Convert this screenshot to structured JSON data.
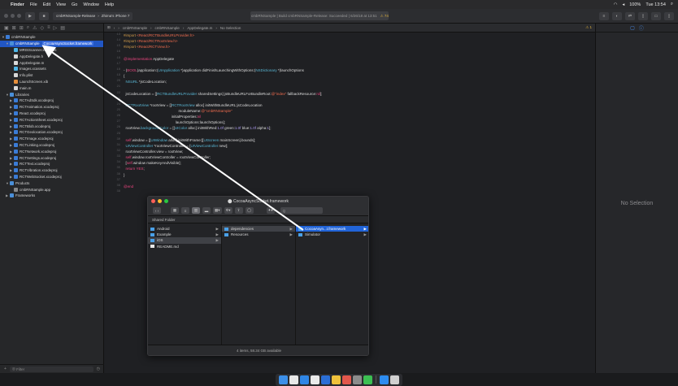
{
  "menubar": {
    "apple": "",
    "items": [
      "Finder",
      "File",
      "Edit",
      "View",
      "Go",
      "Window",
      "Help"
    ],
    "right": {
      "battery": "100%",
      "clock": "Tue 13:54"
    }
  },
  "toolbar": {
    "scheme": "cmbRNSample-Release",
    "device": "Zhima's iPhone 7",
    "status": "cmbRNSample | Build cmbRNSample-Release: Succeeded | 6/26/18 at 13:51",
    "warnings": "⚠ 74"
  },
  "navigator": {
    "rows": [
      {
        "label": "cmbRNSample",
        "icon": "proj",
        "disclosure": "▼",
        "indent": 0
      },
      {
        "label": "cmbRNSample",
        "icon": "folder",
        "disclosure": "▼",
        "indent": 1,
        "selected": true,
        "badge": "CocoaAsyncSocket.framework"
      },
      {
        "label": "MRISScanner.xcassets",
        "icon": "asset",
        "disclosure": "",
        "indent": 2
      },
      {
        "label": "AppDelegate.h",
        "icon": "file",
        "disclosure": "",
        "indent": 2
      },
      {
        "label": "AppDelegate.m",
        "icon": "file",
        "disclosure": "",
        "indent": 2
      },
      {
        "label": "Images.xcassets",
        "icon": "asset",
        "disclosure": "",
        "indent": 2
      },
      {
        "label": "Info.plist",
        "icon": "file",
        "disclosure": "",
        "indent": 2
      },
      {
        "label": "LaunchScreen.xib",
        "icon": "xib",
        "disclosure": "",
        "indent": 2
      },
      {
        "label": "main.m",
        "icon": "file",
        "disclosure": "",
        "indent": 2
      },
      {
        "label": "Libraries",
        "icon": "folder",
        "disclosure": "▼",
        "indent": 1
      },
      {
        "label": "RCTAdSdk.xcodeproj",
        "icon": "proj",
        "disclosure": "▶",
        "indent": 2
      },
      {
        "label": "RCTAnimation.xcodeproj",
        "icon": "proj",
        "disclosure": "▶",
        "indent": 2
      },
      {
        "label": "React.xcodeproj",
        "icon": "proj",
        "disclosure": "▶",
        "indent": 2
      },
      {
        "label": "RCTActionSheet.xcodeproj",
        "icon": "proj",
        "disclosure": "▶",
        "indent": 2
      },
      {
        "label": "RCTBlob.xcodeproj",
        "icon": "proj",
        "disclosure": "▶",
        "indent": 2
      },
      {
        "label": "RCTGeolocation.xcodeproj",
        "icon": "proj",
        "disclosure": "▶",
        "indent": 2
      },
      {
        "label": "RCTImage.xcodeproj",
        "icon": "proj",
        "disclosure": "▶",
        "indent": 2
      },
      {
        "label": "RCTLinking.xcodeproj",
        "icon": "proj",
        "disclosure": "▶",
        "indent": 2
      },
      {
        "label": "RCTNetwork.xcodeproj",
        "icon": "proj",
        "disclosure": "▶",
        "indent": 2
      },
      {
        "label": "RCTSettings.xcodeproj",
        "icon": "proj",
        "disclosure": "▶",
        "indent": 2
      },
      {
        "label": "RCTText.xcodeproj",
        "icon": "proj",
        "disclosure": "▶",
        "indent": 2
      },
      {
        "label": "RCTVibration.xcodeproj",
        "icon": "proj",
        "disclosure": "▶",
        "indent": 2
      },
      {
        "label": "RCTWebSocket.xcodeproj",
        "icon": "proj",
        "disclosure": "▶",
        "indent": 2
      },
      {
        "label": "Products",
        "icon": "folder",
        "disclosure": "▼",
        "indent": 1
      },
      {
        "label": "cmbRNSample.app",
        "icon": "app",
        "disclosure": "",
        "indent": 2
      },
      {
        "label": "Frameworks",
        "icon": "folder",
        "disclosure": "▶",
        "indent": 1
      }
    ],
    "filter_placeholder": "Filter"
  },
  "jumpbar": {
    "path": [
      "cmbRNSample",
      "cmbRNSample",
      "AppDelegate.m",
      "No Selection"
    ],
    "warn": "⚠ 1"
  },
  "code": [
    {
      "n": "13",
      "segs": [
        {
          "c": "mac",
          "t": "#import "
        },
        {
          "c": "str",
          "t": "<React/RCTBundleURLProvider.h>"
        }
      ]
    },
    {
      "n": "14",
      "segs": [
        {
          "c": "mac",
          "t": "#import "
        },
        {
          "c": "str",
          "t": "<React/RCTRootView.h>"
        }
      ]
    },
    {
      "n": "15",
      "segs": [
        {
          "c": "mac",
          "t": "#import "
        },
        {
          "c": "str",
          "t": "<React/RCTView.h>"
        }
      ]
    },
    {
      "n": "16",
      "segs": []
    },
    {
      "n": "16",
      "segs": [
        {
          "c": "kw",
          "t": "@implementation "
        },
        {
          "c": "plain",
          "t": "AppDelegate"
        }
      ]
    },
    {
      "n": "17",
      "segs": []
    },
    {
      "n": "18",
      "segs": [
        {
          "c": "plain",
          "t": "- ("
        },
        {
          "c": "kw",
          "t": "BOOL"
        },
        {
          "c": "plain",
          "t": ")application:("
        },
        {
          "c": "typ",
          "t": "UIApplication"
        },
        {
          "c": "plain",
          "t": " *)application didFinishLaunchingWithOptions:("
        },
        {
          "c": "typ",
          "t": "NSDictionary"
        },
        {
          "c": "plain",
          "t": " *)launchOptions"
        }
      ]
    },
    {
      "n": "19",
      "segs": [
        {
          "c": "plain",
          "t": "{"
        }
      ]
    },
    {
      "n": "20",
      "segs": [
        {
          "c": "plain",
          "t": "  "
        },
        {
          "c": "typ",
          "t": "NSURL"
        },
        {
          "c": "plain",
          "t": " *jsCodeLocation;"
        }
      ]
    },
    {
      "n": "21",
      "segs": []
    },
    {
      "n": "22",
      "segs": [
        {
          "c": "plain",
          "t": "  jsCodeLocation = [["
        },
        {
          "c": "typ",
          "t": "RCTBundleURLProvider"
        },
        {
          "c": "plain",
          "t": " sharedSettings] jsBundleURLForBundleRoot:"
        },
        {
          "c": "str",
          "t": "@\"index\""
        },
        {
          "c": "plain",
          "t": " fallbackResource:"
        },
        {
          "c": "kw",
          "t": "nil"
        },
        {
          "c": "plain",
          "t": "];"
        }
      ]
    },
    {
      "n": "23",
      "segs": []
    },
    {
      "n": "24",
      "segs": [
        {
          "c": "plain",
          "t": "  "
        },
        {
          "c": "typ",
          "t": "RCTRootView"
        },
        {
          "c": "plain",
          "t": " *rootView = [["
        },
        {
          "c": "typ",
          "t": "RCTRootView"
        },
        {
          "c": "plain",
          "t": " alloc] initWithBundleURL:jsCodeLocation"
        }
      ]
    },
    {
      "n": "25",
      "segs": [
        {
          "c": "plain",
          "t": "                                                      moduleName:"
        },
        {
          "c": "str",
          "t": "@\"cmbRNSample\""
        }
      ]
    },
    {
      "n": "26",
      "segs": [
        {
          "c": "plain",
          "t": "                                               initialProperties:"
        },
        {
          "c": "kw",
          "t": "nil"
        }
      ]
    },
    {
      "n": "27",
      "segs": [
        {
          "c": "plain",
          "t": "                                                   launchOptions:launchOptions];"
        }
      ]
    },
    {
      "n": "28",
      "segs": [
        {
          "c": "plain",
          "t": "  rootView."
        },
        {
          "c": "typ",
          "t": "backgroundColor"
        },
        {
          "c": "plain",
          "t": " = [["
        },
        {
          "c": "typ",
          "t": "UIColor"
        },
        {
          "c": "plain",
          "t": " alloc] initWithRed:"
        },
        {
          "c": "num",
          "t": "1.0f"
        },
        {
          "c": "plain",
          "t": " green:"
        },
        {
          "c": "num",
          "t": "1.0f"
        },
        {
          "c": "plain",
          "t": " blue:"
        },
        {
          "c": "num",
          "t": "1.0f"
        },
        {
          "c": "plain",
          "t": " alpha:"
        },
        {
          "c": "num",
          "t": "1"
        },
        {
          "c": "plain",
          "t": "];"
        }
      ]
    },
    {
      "n": "29",
      "segs": []
    },
    {
      "n": "30",
      "segs": [
        {
          "c": "plain",
          "t": "  "
        },
        {
          "c": "kw",
          "t": "self"
        },
        {
          "c": "plain",
          "t": ".window = [["
        },
        {
          "c": "typ",
          "t": "UIWindow"
        },
        {
          "c": "plain",
          "t": " alloc] initWithFrame:[["
        },
        {
          "c": "typ",
          "t": "UIScreen"
        },
        {
          "c": "plain",
          "t": " mainScreen].bounds];"
        }
      ]
    },
    {
      "n": "31",
      "segs": [
        {
          "c": "plain",
          "t": "  "
        },
        {
          "c": "typ",
          "t": "UIViewController"
        },
        {
          "c": "plain",
          "t": " *rootViewController = ["
        },
        {
          "c": "typ",
          "t": "UIViewController"
        },
        {
          "c": "plain",
          "t": " new];"
        }
      ]
    },
    {
      "n": "32",
      "segs": [
        {
          "c": "plain",
          "t": "  rootViewController.view = rootView;"
        }
      ]
    },
    {
      "n": "33",
      "segs": [
        {
          "c": "plain",
          "t": "  "
        },
        {
          "c": "kw",
          "t": "self"
        },
        {
          "c": "plain",
          "t": ".window.rootViewController = rootViewController;"
        }
      ]
    },
    {
      "n": "34",
      "segs": [
        {
          "c": "plain",
          "t": "  ["
        },
        {
          "c": "kw",
          "t": "self"
        },
        {
          "c": "plain",
          "t": ".window makeKeyAndVisible];"
        }
      ]
    },
    {
      "n": "35",
      "segs": [
        {
          "c": "plain",
          "t": "  "
        },
        {
          "c": "kw",
          "t": "return YES"
        },
        {
          "c": "plain",
          "t": ";"
        }
      ]
    },
    {
      "n": "36",
      "segs": [
        {
          "c": "plain",
          "t": "}"
        }
      ]
    },
    {
      "n": "37",
      "segs": []
    },
    {
      "n": "38",
      "segs": [
        {
          "c": "kw",
          "t": "@end"
        }
      ]
    },
    {
      "n": "39",
      "segs": []
    }
  ],
  "inspector": {
    "no_selection": "No Selection"
  },
  "finder": {
    "title": "CocoaAsyncSocket.framework",
    "search_placeholder": "Q",
    "header": "Shared Folder",
    "columns": [
      [
        {
          "label": "Android",
          "icon": "ffolder",
          "chev": "▶"
        },
        {
          "label": "Example",
          "icon": "ffolder",
          "chev": "▶"
        },
        {
          "label": "iOS",
          "icon": "ffolder",
          "chev": "▶",
          "state": "active"
        },
        {
          "label": "README.md",
          "icon": "fdoc",
          "chev": ""
        }
      ],
      [
        {
          "label": "dependencies",
          "icon": "ffolder",
          "chev": "▶",
          "state": "active"
        },
        {
          "label": "Resources",
          "icon": "ffolder",
          "chev": "▶"
        }
      ],
      [
        {
          "label": "CocoaAsyn...t.framework",
          "icon": "ffolder",
          "chev": "▶",
          "state": "selected"
        },
        {
          "label": "Simulator",
          "icon": "ffolder",
          "chev": "▶"
        }
      ]
    ],
    "status": "4 items, 58.34 GB available"
  },
  "colors": {
    "selection": "#2156c4",
    "finder_selection": "#2164d8",
    "keyword": "#e9447e",
    "string": "#ef6c4e",
    "type": "#5ab7d5"
  },
  "dock_icons": [
    "finder-icon",
    "chrome-icon",
    "safari-icon",
    "qq-icon",
    "xcode-icon",
    "photos-icon",
    "music-icon",
    "system-preferences-icon",
    "wechat-icon",
    "app-store-icon",
    "trash-icon"
  ]
}
